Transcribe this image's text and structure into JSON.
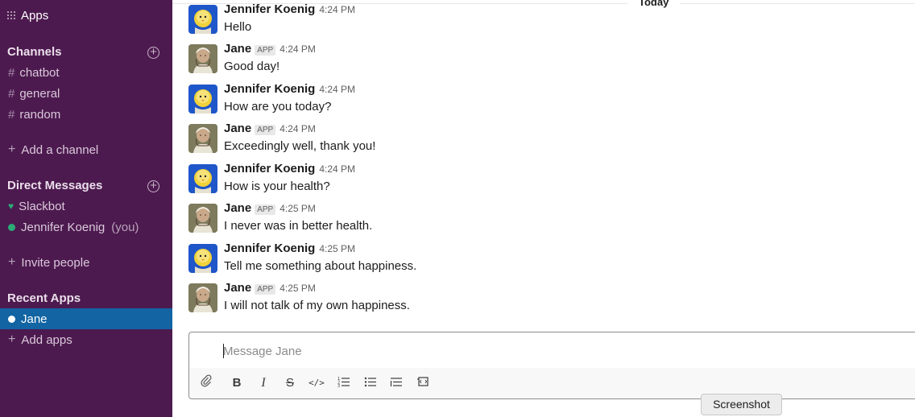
{
  "sidebar": {
    "apps_label": "Apps",
    "channels_title": "Channels",
    "channels": [
      {
        "label": "chatbot"
      },
      {
        "label": "general"
      },
      {
        "label": "random"
      }
    ],
    "add_channel": "Add a channel",
    "dm_title": "Direct Messages",
    "dms": [
      {
        "label": "Slackbot"
      },
      {
        "label": "Jennifer Koenig",
        "suffix": "(you)"
      }
    ],
    "invite_people": "Invite people",
    "recent_apps_title": "Recent Apps",
    "recent_apps": [
      {
        "label": "Jane"
      }
    ],
    "add_apps": "Add apps"
  },
  "main": {
    "day_divider": "Today",
    "messages": [
      {
        "author": "Jennifer Koenig",
        "badge": "",
        "time": "4:24 PM",
        "text": "Hello"
      },
      {
        "author": "Jane",
        "badge": "APP",
        "time": "4:24 PM",
        "text": "Good day!"
      },
      {
        "author": "Jennifer Koenig",
        "badge": "",
        "time": "4:24 PM",
        "text": "How are you today?"
      },
      {
        "author": "Jane",
        "badge": "APP",
        "time": "4:24 PM",
        "text": "Exceedingly well, thank you!"
      },
      {
        "author": "Jennifer Koenig",
        "badge": "",
        "time": "4:24 PM",
        "text": "How is your health?"
      },
      {
        "author": "Jane",
        "badge": "APP",
        "time": "4:25 PM",
        "text": "I never was in better health."
      },
      {
        "author": "Jennifer Koenig",
        "badge": "",
        "time": "4:25 PM",
        "text": "Tell me something about happiness."
      },
      {
        "author": "Jane",
        "badge": "APP",
        "time": "4:25 PM",
        "text": "I will not talk of my own happiness."
      }
    ],
    "composer": {
      "placeholder": "Message Jane",
      "value": ""
    },
    "toolbar_icons": [
      "paperclip-icon",
      "bold-icon",
      "italic-icon",
      "strikethrough-icon",
      "code-icon",
      "ordered-list-icon",
      "bulleted-list-icon",
      "blockquote-icon",
      "code-block-icon"
    ]
  },
  "tooltip": "Screenshot",
  "colors": {
    "sidebar_bg": "#4d1a4f",
    "active_item": "#1264a3",
    "presence_green": "#2bac76"
  }
}
